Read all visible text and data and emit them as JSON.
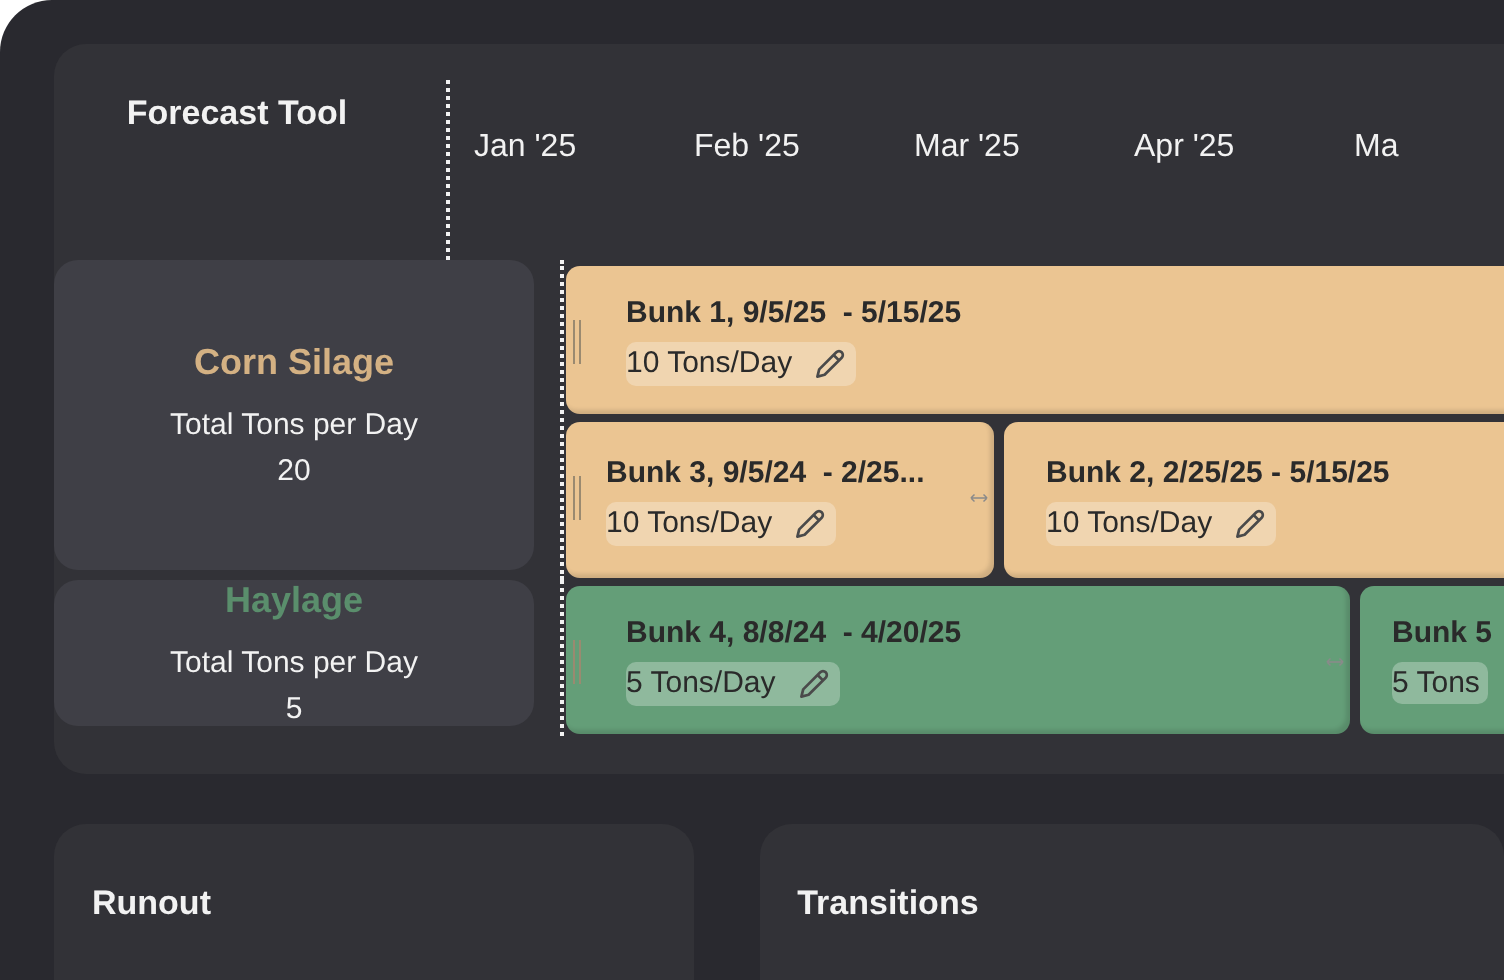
{
  "title": "Forecast Tool",
  "months": [
    "Jan '25",
    "Feb '25",
    "Mar '25",
    "Apr '25",
    "Ma"
  ],
  "groups": [
    {
      "name": "Corn Silage",
      "color": "#ebc592",
      "total_label": "Total Tons per Day",
      "total": "20",
      "lanes": [
        {
          "bars": [
            {
              "title": "Bunk 1, 9/5/25  - 5/15/25",
              "rate": "10 Tons/Day"
            }
          ]
        },
        {
          "bars": [
            {
              "title": "Bunk 3, 9/5/24  - 2/25...",
              "rate": "10 Tons/Day"
            },
            {
              "title": "Bunk 2, 2/25/25 - 5/15/25",
              "rate": "10 Tons/Day"
            }
          ]
        }
      ]
    },
    {
      "name": "Haylage",
      "color": "#649e78",
      "total_label": "Total Tons per Day",
      "total": "5",
      "lanes": [
        {
          "bars": [
            {
              "title": "Bunk 4, 8/8/24  - 4/20/25",
              "rate": "5 Tons/Day"
            },
            {
              "title": "Bunk 5",
              "rate": "5 Tons"
            }
          ]
        }
      ]
    }
  ],
  "panels": [
    {
      "title": "Runout"
    },
    {
      "title": "Transitions"
    }
  ]
}
